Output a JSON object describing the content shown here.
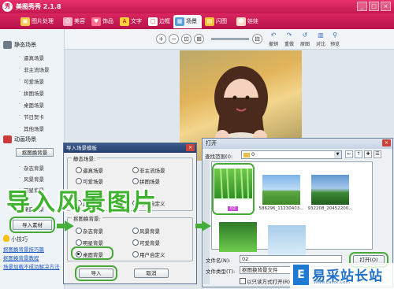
{
  "app": {
    "title": "美图秀秀 2.1.8",
    "logo_char": "秀"
  },
  "window_controls": [
    "_",
    "□",
    "×"
  ],
  "tabs": [
    {
      "label": "图片处理",
      "icon": "picture-icon"
    },
    {
      "label": "美容",
      "icon": "face-icon"
    },
    {
      "label": "饰品",
      "icon": "heart-icon"
    },
    {
      "label": "文字",
      "icon": "text-icon"
    },
    {
      "label": "边框",
      "icon": "frame-icon"
    },
    {
      "label": "场景",
      "icon": "scene-icon"
    },
    {
      "label": "闪图",
      "icon": "flash-icon"
    },
    {
      "label": "娃娃",
      "icon": "doll-icon"
    }
  ],
  "sidebar": {
    "static_scene": "静态场景",
    "static_items": [
      "逼真场景",
      "非主流场景",
      "可爱场景",
      "拼图场景",
      "桌面场景",
      "节日贺卡",
      "其他场景"
    ],
    "animated_scene": "动画场景",
    "bg_replace": "抠图换背景",
    "bg_items": [
      "杂志背景",
      "风景背景",
      "明星背景",
      "桌面背景"
    ],
    "import_button": "导入素材",
    "tip_title": "小技巧",
    "links": [
      "抠图换背景技巧篇",
      "抠图换背景教程",
      "场景加载不成功解决方法"
    ]
  },
  "toolbar": {
    "zoom_in": "+",
    "zoom_out": "−",
    "actions": [
      {
        "label": "撤销",
        "icon": "↶"
      },
      {
        "label": "重做",
        "icon": "↷"
      },
      {
        "label": "原图",
        "icon": "↺"
      },
      {
        "label": "对比",
        "icon": "▥"
      },
      {
        "label": "预览",
        "icon": "⚲"
      }
    ]
  },
  "import_dialog": {
    "title": "导入场景模板",
    "static_group": "静态场景:",
    "static_options": [
      "逼真场景",
      "非主流场景",
      "可爱场景",
      "拼图场景",
      "其他场景",
      "用户自定义"
    ],
    "bg_group": "抠图换背景:",
    "bg_options": [
      "杂志背景",
      "风景背景",
      "明星背景",
      "可爱背景",
      "桌面背景",
      "用户自定义"
    ],
    "selected": "桌面背景",
    "import_btn": "导入",
    "cancel_btn": "取消"
  },
  "overlay_text": "导入风景图片",
  "open_dialog": {
    "title": "打开",
    "look_in_label": "查找范围(I):",
    "look_in_value": "0",
    "files": [
      "02",
      "586296_11230403...",
      "932208_20452200..."
    ],
    "filename_label": "文件名(N):",
    "filename_value": "02",
    "filetype_label": "文件类型(T):",
    "filetype_value": "抠图换背景文件",
    "readonly_label": "以只读方式打开(R)",
    "open_btn": "打开(O)"
  },
  "watermark": {
    "text": "易采站长站",
    "sub": "Www.Easck.Com",
    "logo": "E"
  }
}
